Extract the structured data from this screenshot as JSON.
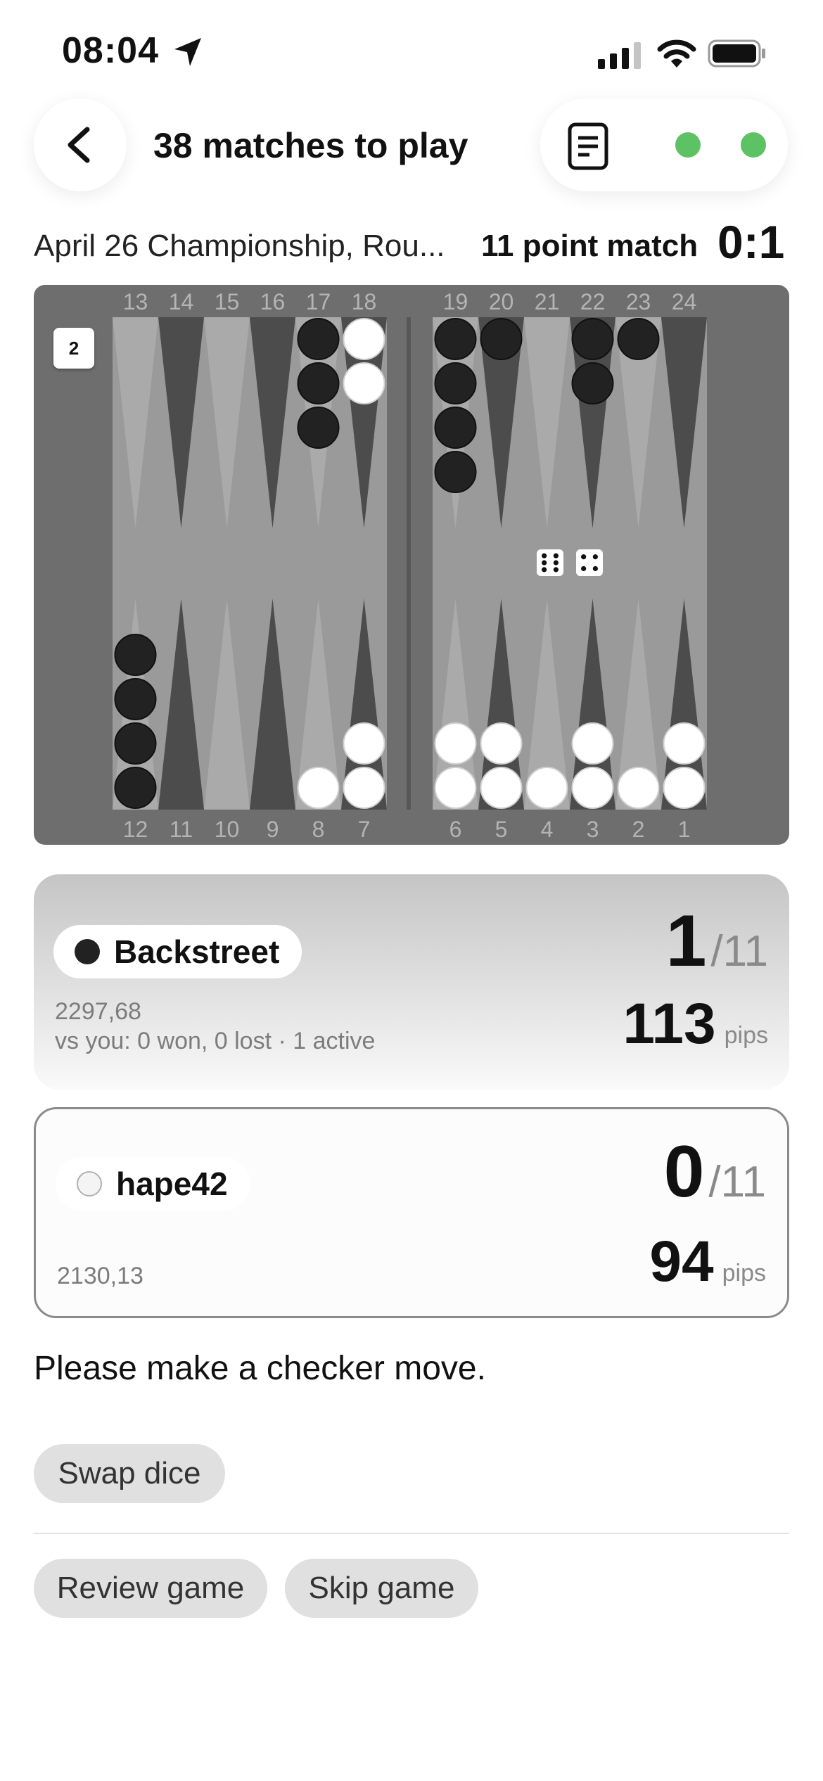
{
  "status_bar": {
    "time": "08:04"
  },
  "header": {
    "title": "38 matches to play"
  },
  "match": {
    "tournament": "April 26 Championship, Rou...",
    "length": "11 point match",
    "score": "0:1"
  },
  "board": {
    "top_points": [
      "13",
      "14",
      "15",
      "16",
      "17",
      "18",
      "19",
      "20",
      "21",
      "22",
      "23",
      "24"
    ],
    "bottom_points": [
      "12",
      "11",
      "10",
      "9",
      "8",
      "7",
      "6",
      "5",
      "4",
      "3",
      "2",
      "1"
    ],
    "cube": "2",
    "dice": [
      6,
      4
    ],
    "checkers": {
      "black": {
        "17": 3,
        "19": 4,
        "20": 1,
        "22": 2,
        "23": 1,
        "12": 4
      },
      "white": {
        "18": 2,
        "8": 1,
        "7": 2,
        "6": 2,
        "5": 2,
        "4": 1,
        "3": 2,
        "2": 1,
        "1": 2
      }
    },
    "colors": {
      "frame": "#6e6e6e",
      "field": "#9a9a9a",
      "dark_point": "#4c4c4c",
      "light_point": "#aaaaaa",
      "black_checker": "#222222",
      "white_checker": "#ffffff"
    }
  },
  "players": [
    {
      "name": "Backstreet",
      "color": "black",
      "rating": "2297,68",
      "record": "vs you: 0 won, 0 lost · 1 active",
      "score": "1",
      "out_of": "/11",
      "pips": "113",
      "pips_label": "pips"
    },
    {
      "name": "hape42",
      "color": "white",
      "rating": "2130,13",
      "score": "0",
      "out_of": "/11",
      "pips": "94",
      "pips_label": "pips"
    }
  ],
  "prompt": "Please make a checker move.",
  "actions": {
    "swap_dice": "Swap dice",
    "review_game": "Review game",
    "skip_game": "Skip game"
  },
  "accent": {
    "online": "#5cc264"
  }
}
